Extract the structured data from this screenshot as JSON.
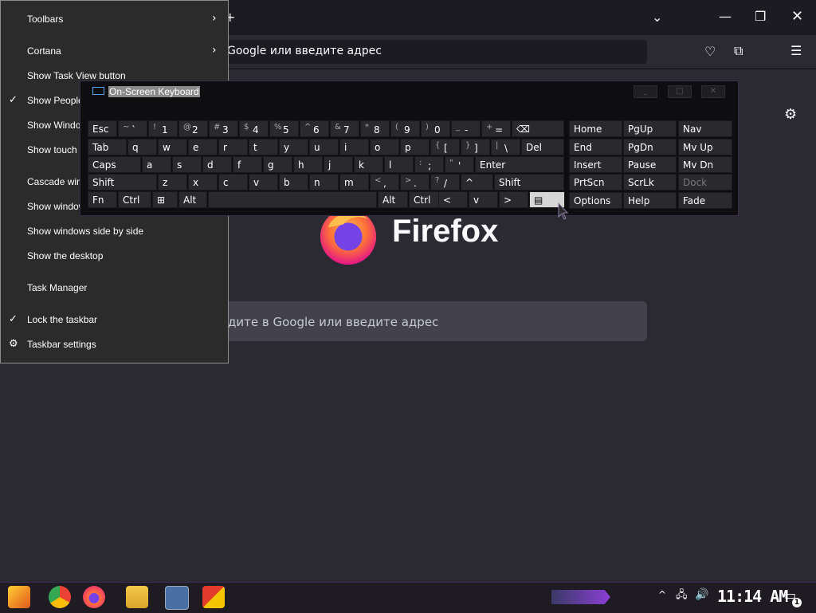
{
  "firefox": {
    "url_placeholder": "Google или введите адрес",
    "brand": "Firefox",
    "search_placeholder": "дите в Google или введите адрес",
    "new_tab_glyph": "+"
  },
  "context_menu": {
    "items": [
      {
        "label": "Toolbars",
        "checked": false,
        "submenu": true
      },
      {
        "label": "Cortana",
        "checked": false,
        "submenu": true
      },
      {
        "label": "Show Task View button",
        "checked": false,
        "submenu": false
      },
      {
        "label": "Show People",
        "checked": true,
        "submenu": false
      },
      {
        "label": "Show Window",
        "checked": false,
        "submenu": false
      },
      {
        "label": "Show touch k",
        "checked": false,
        "submenu": false
      },
      {
        "label": "Cascade wind",
        "checked": false,
        "submenu": false
      },
      {
        "label": "Show window",
        "checked": false,
        "submenu": false
      },
      {
        "label": "Show windows side by side",
        "checked": false,
        "submenu": false
      },
      {
        "label": "Show the desktop",
        "checked": false,
        "submenu": false
      },
      {
        "label": "Task Manager",
        "checked": false,
        "submenu": false
      },
      {
        "label": "Lock the taskbar",
        "checked": true,
        "submenu": false
      },
      {
        "label": "Taskbar settings",
        "checked": false,
        "submenu": false
      }
    ]
  },
  "osk": {
    "title": "On-Screen Keyboard",
    "row1": [
      {
        "k": "Esc"
      },
      {
        "s": "~",
        "m": "`"
      },
      {
        "s": "!",
        "m": "1"
      },
      {
        "s": "@",
        "m": "2"
      },
      {
        "s": "#",
        "m": "3"
      },
      {
        "s": "$",
        "m": "4"
      },
      {
        "s": "%",
        "m": "5"
      },
      {
        "s": "^",
        "m": "6"
      },
      {
        "s": "&",
        "m": "7"
      },
      {
        "s": "*",
        "m": "8"
      },
      {
        "s": "(",
        "m": "9"
      },
      {
        "s": ")",
        "m": "0"
      },
      {
        "s": "_",
        "m": "-"
      },
      {
        "s": "+",
        "m": "="
      },
      {
        "k": "⌫"
      }
    ],
    "row2": [
      "Tab",
      "q",
      "w",
      "e",
      "r",
      "t",
      "y",
      "u",
      "i",
      "o",
      "p",
      "[",
      "]",
      "\\",
      "Del"
    ],
    "row2_shift": [
      "",
      "",
      "",
      "",
      "",
      "",
      "",
      "",
      "",
      "",
      "",
      "{",
      "}",
      "|",
      ""
    ],
    "row3": [
      "Caps",
      "a",
      "s",
      "d",
      "f",
      "g",
      "h",
      "j",
      "k",
      "l",
      ";",
      "'",
      "Enter"
    ],
    "row3_shift": [
      "",
      "",
      "",
      "",
      "",
      "",
      "",
      "",
      "",
      "",
      ":",
      "\"",
      ""
    ],
    "row4": [
      "Shift",
      "z",
      "x",
      "c",
      "v",
      "b",
      "n",
      "m",
      ",",
      ".",
      "/",
      "^",
      "Shift"
    ],
    "row4_shift": [
      "",
      "",
      "",
      "",
      "",
      "",
      "",
      "",
      "<",
      ">",
      "?",
      "",
      ""
    ],
    "row5": [
      "Fn",
      "Ctrl",
      "⊞",
      "Alt",
      "",
      "Alt",
      "Ctrl",
      "<",
      "v",
      ">",
      "▤"
    ],
    "nav": [
      [
        "Home",
        "PgUp",
        "Nav"
      ],
      [
        "End",
        "PgDn",
        "Mv Up"
      ],
      [
        "Insert",
        "Pause",
        "Mv Dn"
      ],
      [
        "PrtScn",
        "ScrLk",
        "Dock"
      ],
      [
        "Options",
        "Help",
        "Fade"
      ]
    ]
  },
  "taskbar": {
    "clock": "11:14 AM",
    "notification_count": "1"
  },
  "colors": {
    "accent": "#8b3fd6",
    "firefox_bg": "#2b2a33"
  }
}
